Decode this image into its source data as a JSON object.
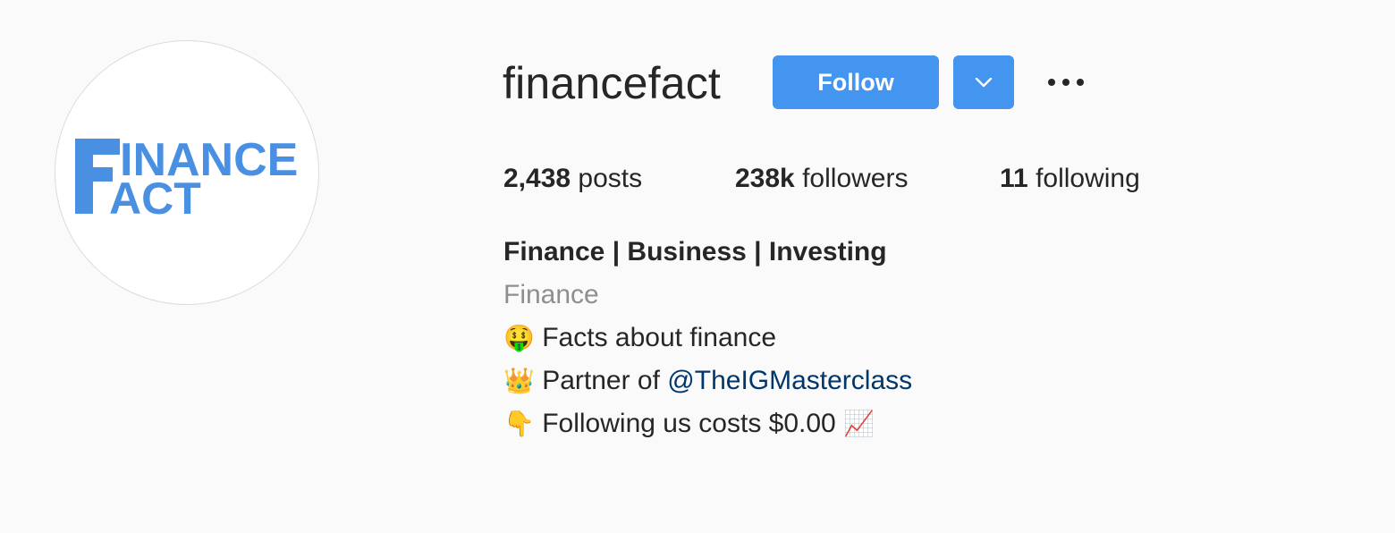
{
  "profile": {
    "username": "financefact",
    "follow_label": "Follow",
    "logo_text_line1": "INANCE",
    "logo_text_line2": "ACT",
    "avatar_icon": "finance-fact-logo"
  },
  "stats": {
    "posts_count": "2,438",
    "posts_label": "posts",
    "followers_count": "238k",
    "followers_label": "followers",
    "following_count": "11",
    "following_label": "following"
  },
  "bio": {
    "full_name": "Finance | Business | Investing",
    "category": "Finance",
    "line1_emoji": "🤑",
    "line1_text": "Facts about finance",
    "line2_emoji": "👑",
    "line2_text": "Partner of",
    "line2_mention": "@TheIGMasterclass",
    "line3_emoji": "👇",
    "line3_text": "Following us costs $0.00",
    "line3_emoji_end": "📈"
  },
  "colors": {
    "accent": "#4495ef",
    "background": "#fafafa",
    "text": "#262626",
    "muted": "#8e8e8e",
    "link": "#00376b"
  }
}
